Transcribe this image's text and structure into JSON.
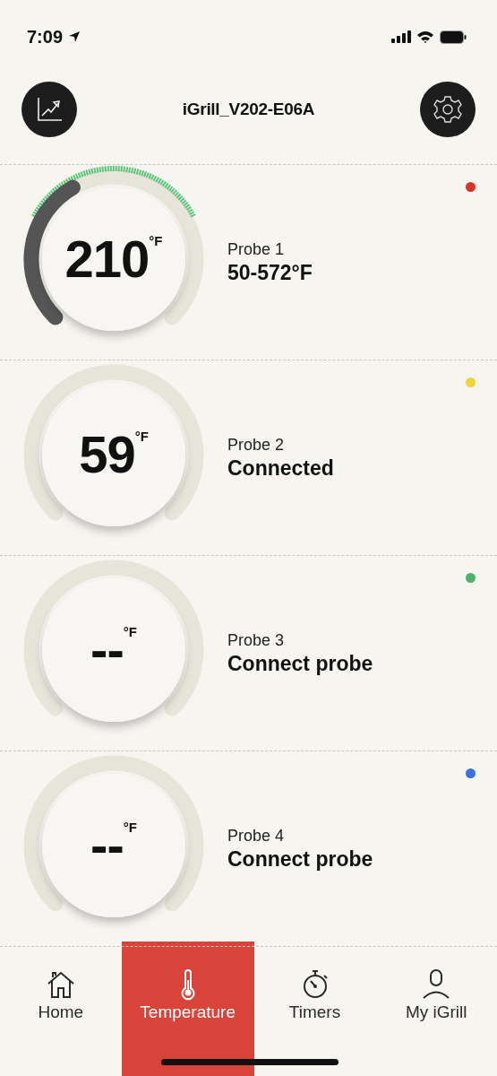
{
  "status_bar": {
    "time": "7:09"
  },
  "header": {
    "title": "iGrill_V202-E06A"
  },
  "probes": [
    {
      "reading": "210",
      "unit": "°F",
      "name": "Probe 1",
      "status": "50-572°F",
      "color": "#d9362b",
      "range_set": true
    },
    {
      "reading": "59",
      "unit": "°F",
      "name": "Probe 2",
      "status": "Connected",
      "color": "#ecd63a",
      "range_set": false
    },
    {
      "reading": "--",
      "unit": "°F",
      "name": "Probe 3",
      "status": "Connect probe",
      "color": "#4fb26a",
      "range_set": false
    },
    {
      "reading": "--",
      "unit": "°F",
      "name": "Probe 4",
      "status": "Connect probe",
      "color": "#3d6fe0",
      "range_set": false
    }
  ],
  "tabs": [
    {
      "kind": "home",
      "label": "Home",
      "selected": false
    },
    {
      "kind": "temperature",
      "label": "Temperature",
      "selected": true
    },
    {
      "kind": "timers",
      "label": "Timers",
      "selected": false
    },
    {
      "kind": "profile",
      "label": "My iGrill",
      "selected": false
    }
  ]
}
